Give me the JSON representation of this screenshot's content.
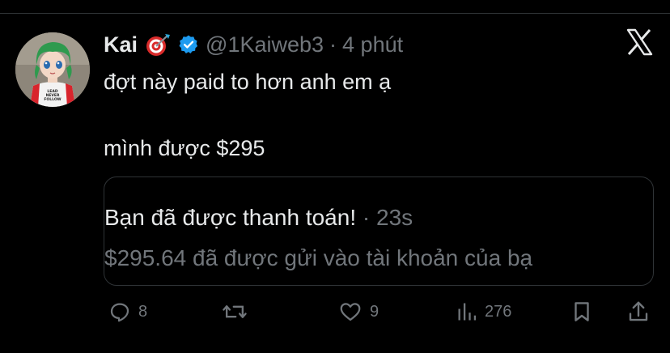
{
  "tweet": {
    "author_name": "Kai",
    "handle": "@1Kaiweb3",
    "separator": "·",
    "time": "4 phút",
    "line1": "đợt này paid to hơn anh em ạ",
    "line2": "mình được $295"
  },
  "card": {
    "title": "Bạn đã được thanh toán!",
    "title_meta": "· 23s",
    "body": "$295.64 đã được gửi vào tài khoản của bạ"
  },
  "actions": {
    "replies": "8",
    "likes": "9",
    "views": "276"
  },
  "avatar_text": [
    "LEAD",
    "NEVER",
    "FOLLOW"
  ],
  "colors": {
    "background": "#000000",
    "text": "#e7e9ea",
    "muted": "#71767b",
    "verified": "#1d9bf0",
    "border": "#2f3336"
  }
}
